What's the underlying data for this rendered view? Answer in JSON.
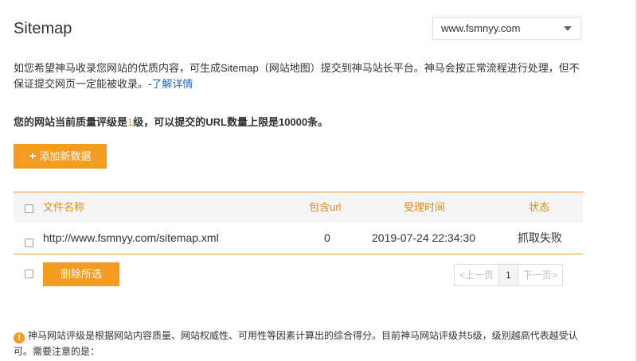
{
  "header": {
    "title": "Sitemap",
    "site_selected": "www.fsmnyy.com"
  },
  "intro": {
    "text": "如您希望神马收录您网站的优质内容，可生成Sitemap（网站地图）提交到神马站长平台。神马会按正常流程进行处理，但不保证提交网页一定能被收录。-",
    "link": "了解详情"
  },
  "quality": {
    "prefix": "您的网站当前质量评级是",
    "level": "1",
    "suffix": "级，可以提交的URL数量上限是10000条。"
  },
  "actions": {
    "add_label": "添加新数据",
    "add_icon": "plus-icon",
    "delete_label": "删除所选"
  },
  "table": {
    "columns": [
      "文件名称",
      "包含url",
      "受理时间",
      "状态"
    ],
    "rows": [
      {
        "file": "http://www.fsmnyy.com/sitemap.xml",
        "url_count": "0",
        "time": "2019-07-24 22:34:30",
        "status": "抓取失败"
      }
    ]
  },
  "pager": {
    "prev": "<上一页",
    "current": "1",
    "next": "下一页>"
  },
  "notice": {
    "icon": "warning-icon",
    "text": "神马网站评级是根据网站内容质量、网站权威性、可用性等因素计算出的综合得分。目前神马网站评级共5级，级别越高代表越受认可。需要注意的是："
  },
  "colors": {
    "accent": "#f39c1f",
    "header_text": "#e08a18",
    "link": "#1f63c5"
  }
}
